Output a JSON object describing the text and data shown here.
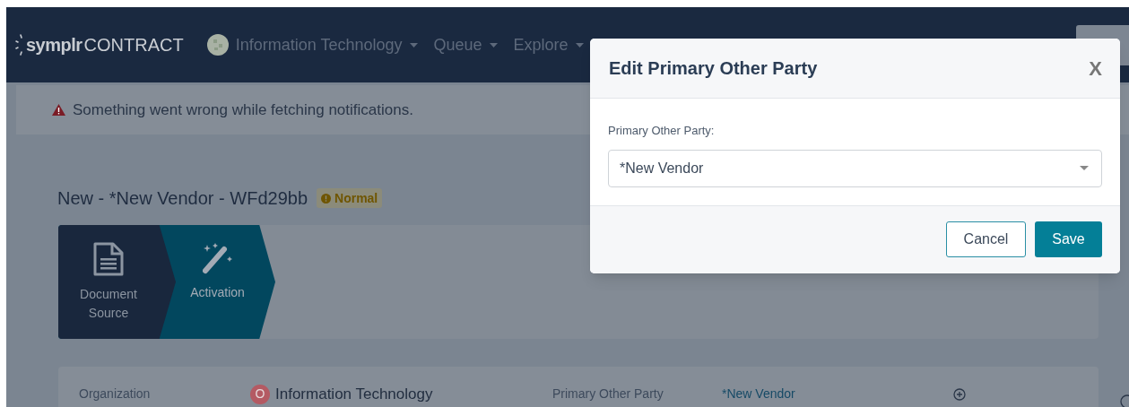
{
  "navbar": {
    "logo": {
      "brand": "symplr",
      "product": "CONTRACT"
    },
    "menus": [
      {
        "label": "Information Technology",
        "kind": "org"
      },
      {
        "label": "Queue",
        "kind": "menu"
      },
      {
        "label": "Explore",
        "kind": "menu"
      }
    ]
  },
  "alert": {
    "message": "Something went wrong while fetching notifications."
  },
  "record": {
    "title": "New - *New Vendor - WFd29bb",
    "priority": "Normal"
  },
  "steps": [
    {
      "label": "Document Source",
      "kind": "document",
      "selected": false
    },
    {
      "label": "Activation",
      "kind": "wand",
      "selected": true
    }
  ],
  "details": [
    {
      "label": "Organization",
      "value": "Information Technology",
      "badge": "O",
      "kind": "org"
    },
    {
      "label": "Primary Other Party",
      "value": "*New Vendor",
      "kind": "link"
    }
  ],
  "dialog": {
    "title": "Edit Primary Other Party",
    "close": "X",
    "field": {
      "label": "Primary Other Party:",
      "value": "*New Vendor"
    },
    "buttons": [
      {
        "label": "Cancel",
        "kind": "secondary"
      },
      {
        "label": "Save",
        "kind": "primary"
      }
    ]
  }
}
